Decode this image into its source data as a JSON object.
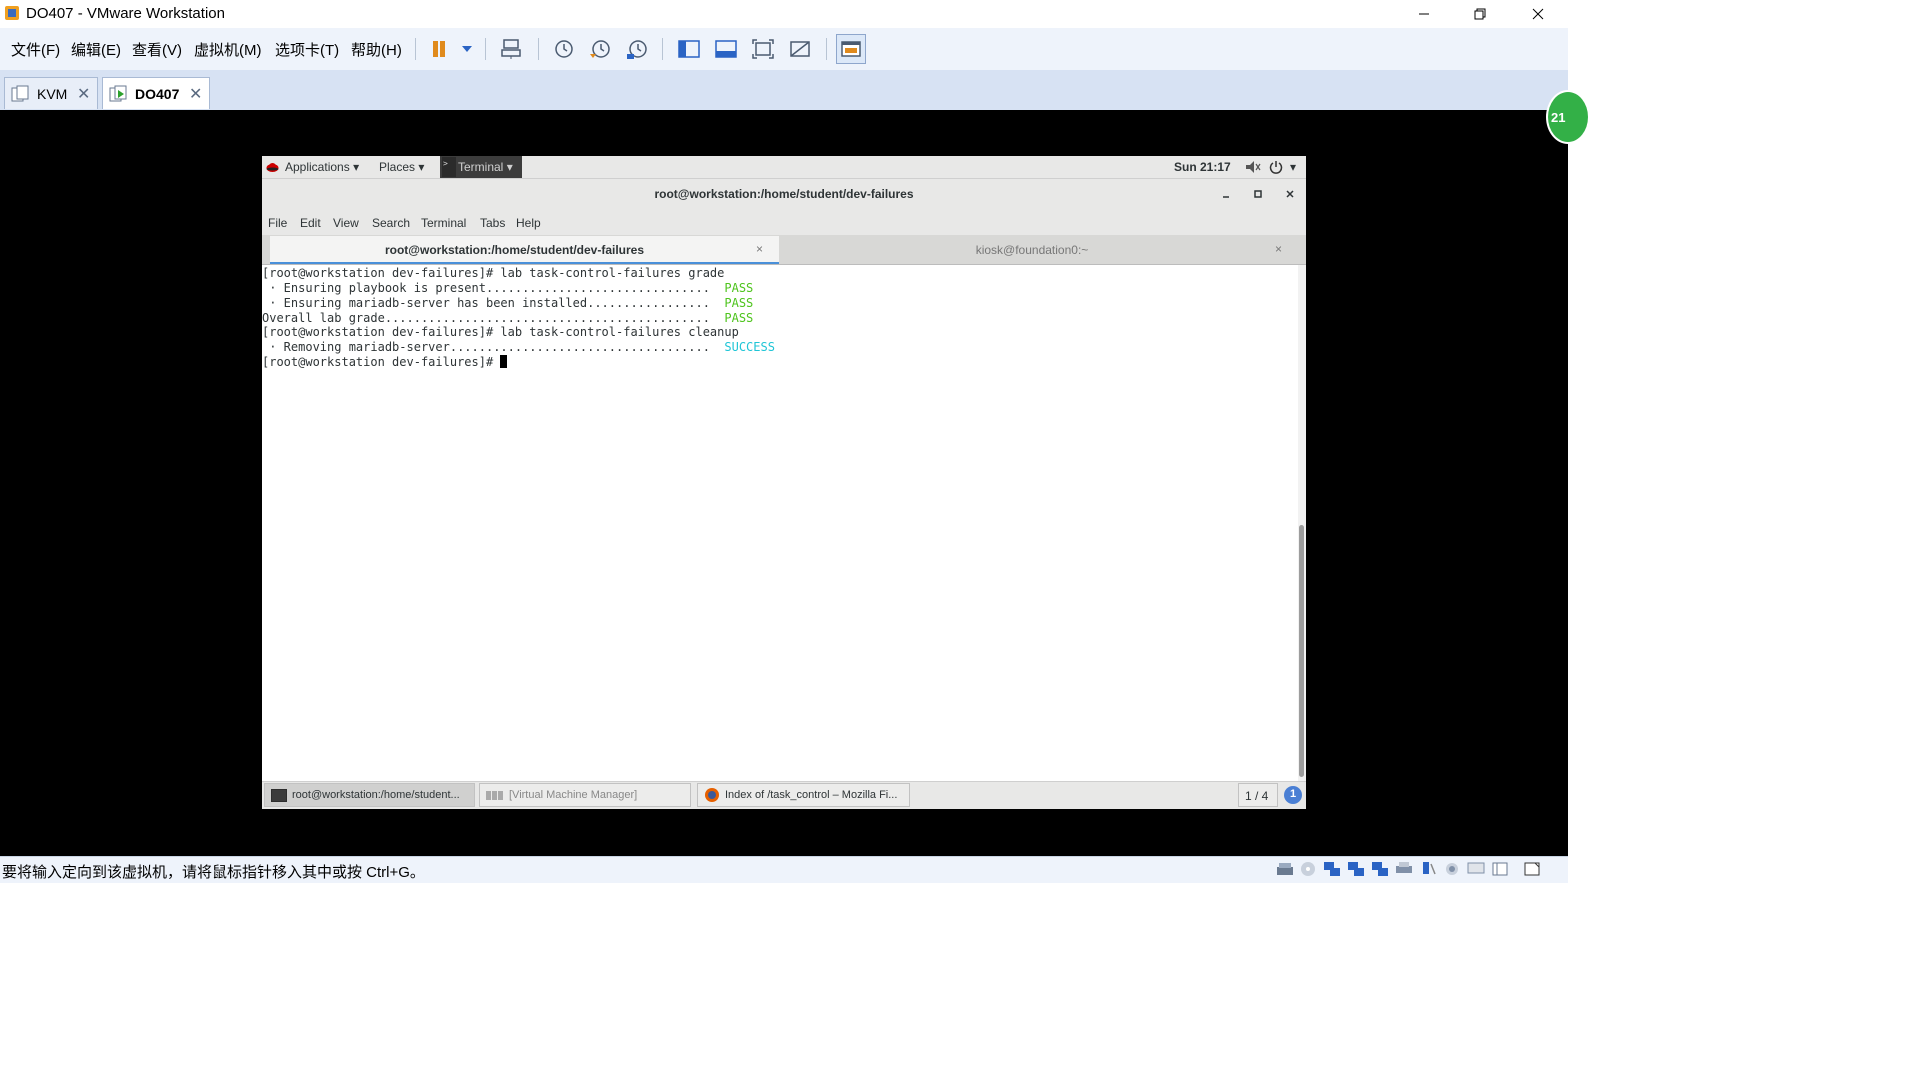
{
  "window": {
    "title": "DO407 - VMware Workstation"
  },
  "menu": [
    "文件(F)",
    "编辑(E)",
    "查看(V)",
    "虚拟机(M)",
    "选项卡(T)",
    "帮助(H)"
  ],
  "vm_tabs": [
    {
      "label": "KVM",
      "active": false
    },
    {
      "label": "DO407",
      "active": true
    }
  ],
  "badge_text": "21",
  "guest": {
    "topbar": {
      "applications": "Applications",
      "places": "Places",
      "terminal": "Terminal",
      "clock": "Sun 21:17"
    },
    "terminal": {
      "title": "root@workstation:/home/student/dev-failures",
      "menu": [
        "File",
        "Edit",
        "View",
        "Search",
        "Terminal",
        "Tabs",
        "Help"
      ],
      "tabs": [
        {
          "label": "root@workstation:/home/student/dev-failures",
          "active": true
        },
        {
          "label": "kiosk@foundation0:~",
          "active": false
        }
      ],
      "lines": [
        {
          "text": "[root@workstation dev-failures]# lab task-control-failures grade",
          "status": "",
          "kind": ""
        },
        {
          "text": " · Ensuring playbook is present...............................  ",
          "status": "PASS",
          "kind": "pass"
        },
        {
          "text": " · Ensuring mariadb-server has been installed.................  ",
          "status": "PASS",
          "kind": "pass"
        },
        {
          "text": "Overall lab grade.............................................  ",
          "status": "PASS",
          "kind": "pass"
        },
        {
          "text": "[root@workstation dev-failures]# lab task-control-failures cleanup",
          "status": "",
          "kind": ""
        },
        {
          "text": " · Removing mariadb-server....................................  ",
          "status": "SUCCESS",
          "kind": "success"
        },
        {
          "text": "[root@workstation dev-failures]# ",
          "status": "",
          "kind": "prompt"
        }
      ]
    },
    "taskbar": {
      "items": [
        {
          "label": "root@workstation:/home/student...",
          "active": true
        },
        {
          "label": "[Virtual Machine Manager]",
          "active": false
        },
        {
          "label": "Index of /task_control – Mozilla Fi...",
          "active": false
        }
      ],
      "workspace": "1 / 4",
      "notification_count": "1"
    }
  },
  "statusbar": {
    "text": "要将输入定向到该虚拟机，请将鼠标指针移入其中或按 Ctrl+G。"
  }
}
